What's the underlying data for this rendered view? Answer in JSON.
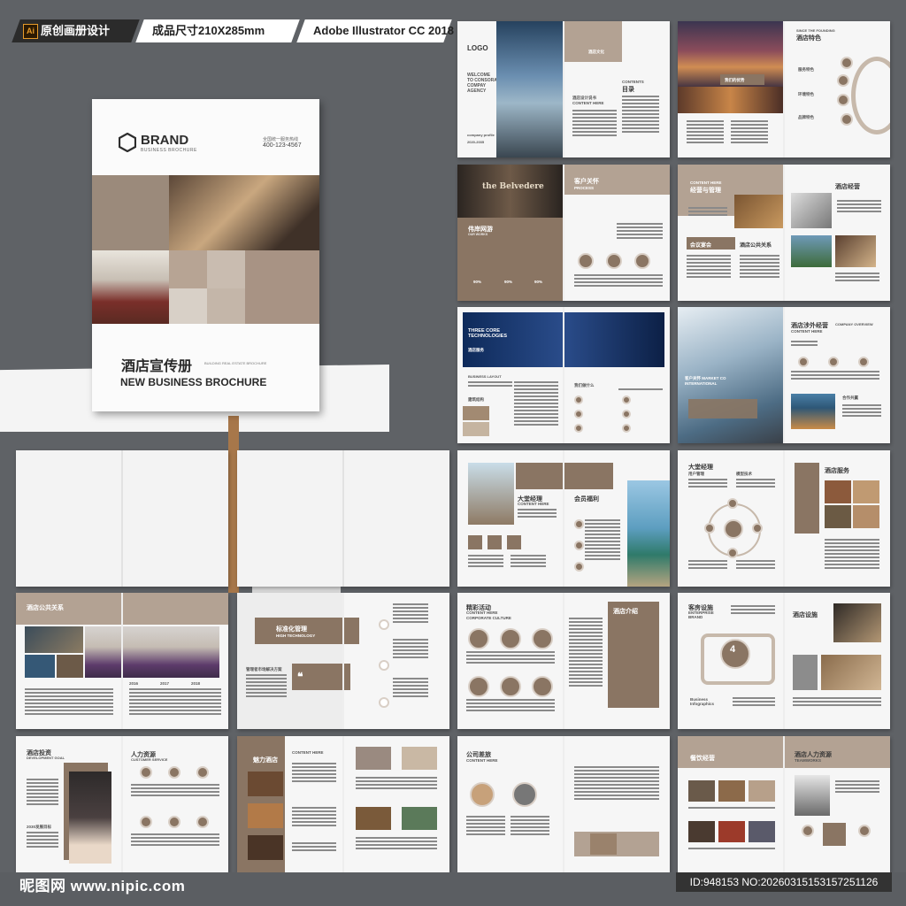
{
  "tags": {
    "ai_badge": "Ai",
    "tag1": "原创画册设计",
    "tag2": "成品尺寸210X285mm",
    "tag3": "Adobe Illustrator CC 2018"
  },
  "cover": {
    "brand": "BRAND",
    "brand_sub": "BUSINESS BROCHURE",
    "hotline_label": "全国统一服务热线",
    "hotline": "400-123-4567",
    "title_cn": "酒店宣传册",
    "title_small": "BUILDING REAL ESTATE BROCHURE",
    "title_en": "NEW BUSINESS BROCHURE"
  },
  "spreads": {
    "s1": {
      "logo": "LOGO",
      "welcome": "WELCOME TO CONSORA COMPAY AGENCY",
      "profile": "company profile",
      "years": "2020-2035",
      "contents": "CONTENTS",
      "mulu": "目录",
      "intro": "酒店设计说书",
      "content_here": "CONTENT HERE",
      "about": "酒店文化"
    },
    "s2": {
      "since": "SINCE THE FOUNDING",
      "title": "酒店特色",
      "item1": "服务特色",
      "item2": "环境特色",
      "item3": "品牌特色",
      "item4": "我们的优势"
    },
    "s3": {
      "belvedere": "the Belvedere",
      "title": "客户关怀",
      "process": "PROCESS",
      "ours": "伟岸网游",
      "our_works": "OUR WORKS",
      "p1": "90%",
      "p2": "90%",
      "p3": "90%"
    },
    "s4": {
      "content_here": "CONTENT HERE",
      "manage": "经营与管理",
      "title": "酒店经营",
      "meeting": "会议宴会",
      "public": "酒店公共关系"
    },
    "s5": {
      "three": "THREE CORE TECHNOLOGIES",
      "service": "酒店服务",
      "layout": "BUSINESS LAYOUT",
      "do": "我们做什么",
      "build": "建筑结构"
    },
    "s6": {
      "title": "酒店涉外经营",
      "content_here": "CONTENT HERE",
      "company": "COMPANY OVERVIEW",
      "market": "客户关怀 MARKET CO INTERNATIONAL",
      "partner": "合作共赢"
    },
    "s7": {
      "title1": "大堂经理",
      "content_here": "CONTENT HERE",
      "title2": "会员福利"
    },
    "s8": {
      "title1": "大堂经理",
      "title2": "酒店服务",
      "user": "用户管理",
      "model": "模型技术"
    },
    "s9": {
      "title": "酒店公共关系",
      "stat1": "2016",
      "stat2": "2017",
      "stat3": "2018"
    },
    "s10": {
      "title": "标准化管理",
      "high": "HIGH TECHNOLOGY",
      "plan": "管理者市场解决方案"
    },
    "s11": {
      "title": "精彩活动",
      "content_here": "CONTENT HERE",
      "corporate": "CORPORATE CULTURE",
      "title2": "酒店介绍"
    },
    "s12": {
      "title": "客房设施",
      "enterprise": "ENTERPRISE BRAND",
      "number": "4",
      "info": "Business Infographics",
      "title2": "酒店设施"
    },
    "s13": {
      "title": "酒店投资",
      "dev": "DEVELOPMENT GOAL",
      "title2": "人力资源",
      "customer": "CUSTOMER SERVICE",
      "year": "2030发展目标"
    },
    "s14": {
      "title": "魅力酒店",
      "content_here": "CONTENT HERE"
    },
    "s15": {
      "title": "公司差旅",
      "content_here": "CONTENT HERE"
    },
    "s16": {
      "title": "餐饮经营",
      "title2": "酒店人力资源",
      "team": "TEAMWORKS"
    }
  },
  "footer": {
    "site": "昵图网 www.nipic.com",
    "id": "ID:948153 NO:20260315153157251126"
  },
  "colors": {
    "background": "#5f6266",
    "brown": "#8a7563",
    "tan": "#b3a293",
    "page": "#f6f6f6"
  }
}
